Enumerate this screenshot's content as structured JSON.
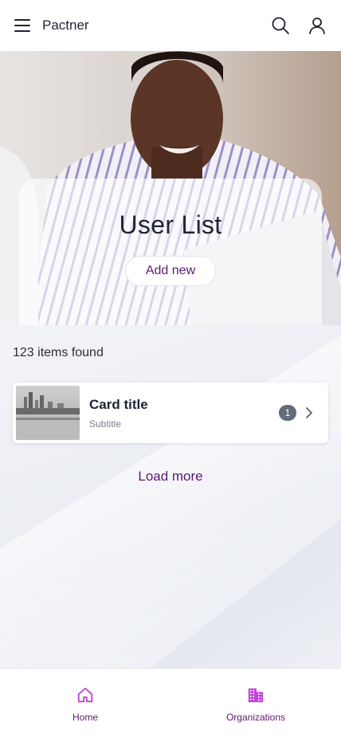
{
  "header": {
    "title": "Pactner",
    "icons": [
      "menu-icon",
      "search-icon",
      "user-icon"
    ]
  },
  "hero": {
    "title": "User List",
    "add_label": "Add new"
  },
  "results": {
    "count_text": "123 items found"
  },
  "cards": [
    {
      "title": "Card title",
      "subtitle": "Subtitle",
      "badge": "1",
      "icon": "chevron-right-icon"
    }
  ],
  "load_more_label": "Load more",
  "bottom_nav": {
    "items": [
      {
        "label": "Home",
        "icon": "home-icon"
      },
      {
        "label": "Organizations",
        "icon": "building-icon"
      }
    ]
  },
  "colors": {
    "accent": "#5b1b6e",
    "nav_icon": "#c03fd8",
    "badge": "#656b7a"
  }
}
